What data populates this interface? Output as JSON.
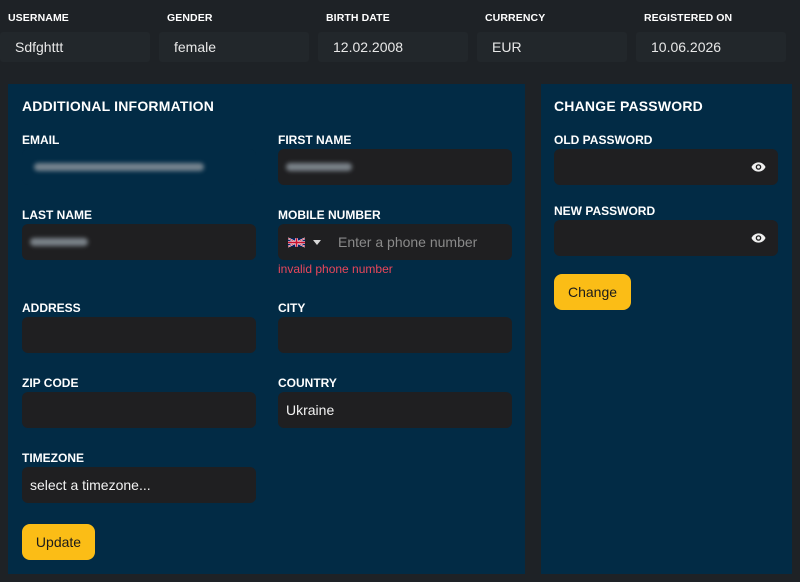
{
  "profile_strip": {
    "columns": [
      {
        "header": "USERNAME",
        "value": "Sdfghttt"
      },
      {
        "header": "GENDER",
        "value": "female"
      },
      {
        "header": "BIRTH DATE",
        "value": "12.02.2008"
      },
      {
        "header": "CURRENCY",
        "value": "EUR"
      },
      {
        "header": "REGISTERED ON",
        "value": "10.06.2026"
      }
    ]
  },
  "additional_info": {
    "title": "ADDITIONAL INFORMATION",
    "email_label": "EMAIL",
    "first_name_label": "FIRST NAME",
    "last_name_label": "LAST NAME",
    "mobile_label": "MOBILE NUMBER",
    "mobile_placeholder": "Enter a phone number",
    "mobile_error": "invalid phone number",
    "address_label": "ADDRESS",
    "address_value": "",
    "city_label": "CITY",
    "city_value": "",
    "zip_label": "ZIP CODE",
    "zip_value": "",
    "country_label": "COUNTRY",
    "country_value": "Ukraine",
    "timezone_label": "TIMEZONE",
    "timezone_value": "select a timezone...",
    "update_label": "Update"
  },
  "change_password": {
    "title": "CHANGE PASSWORD",
    "old_label": "OLD PASSWORD",
    "new_label": "NEW PASSWORD",
    "change_label": "Change"
  },
  "colors": {
    "page_background": "#1e2226",
    "panel_background": "#022b45",
    "input_background": "#1f1f21",
    "accent_button": "#fbbd16",
    "error_text": "#e8475a"
  },
  "icons": [
    "uk-flag-icon",
    "chevron-down-icon",
    "eye-icon"
  ]
}
